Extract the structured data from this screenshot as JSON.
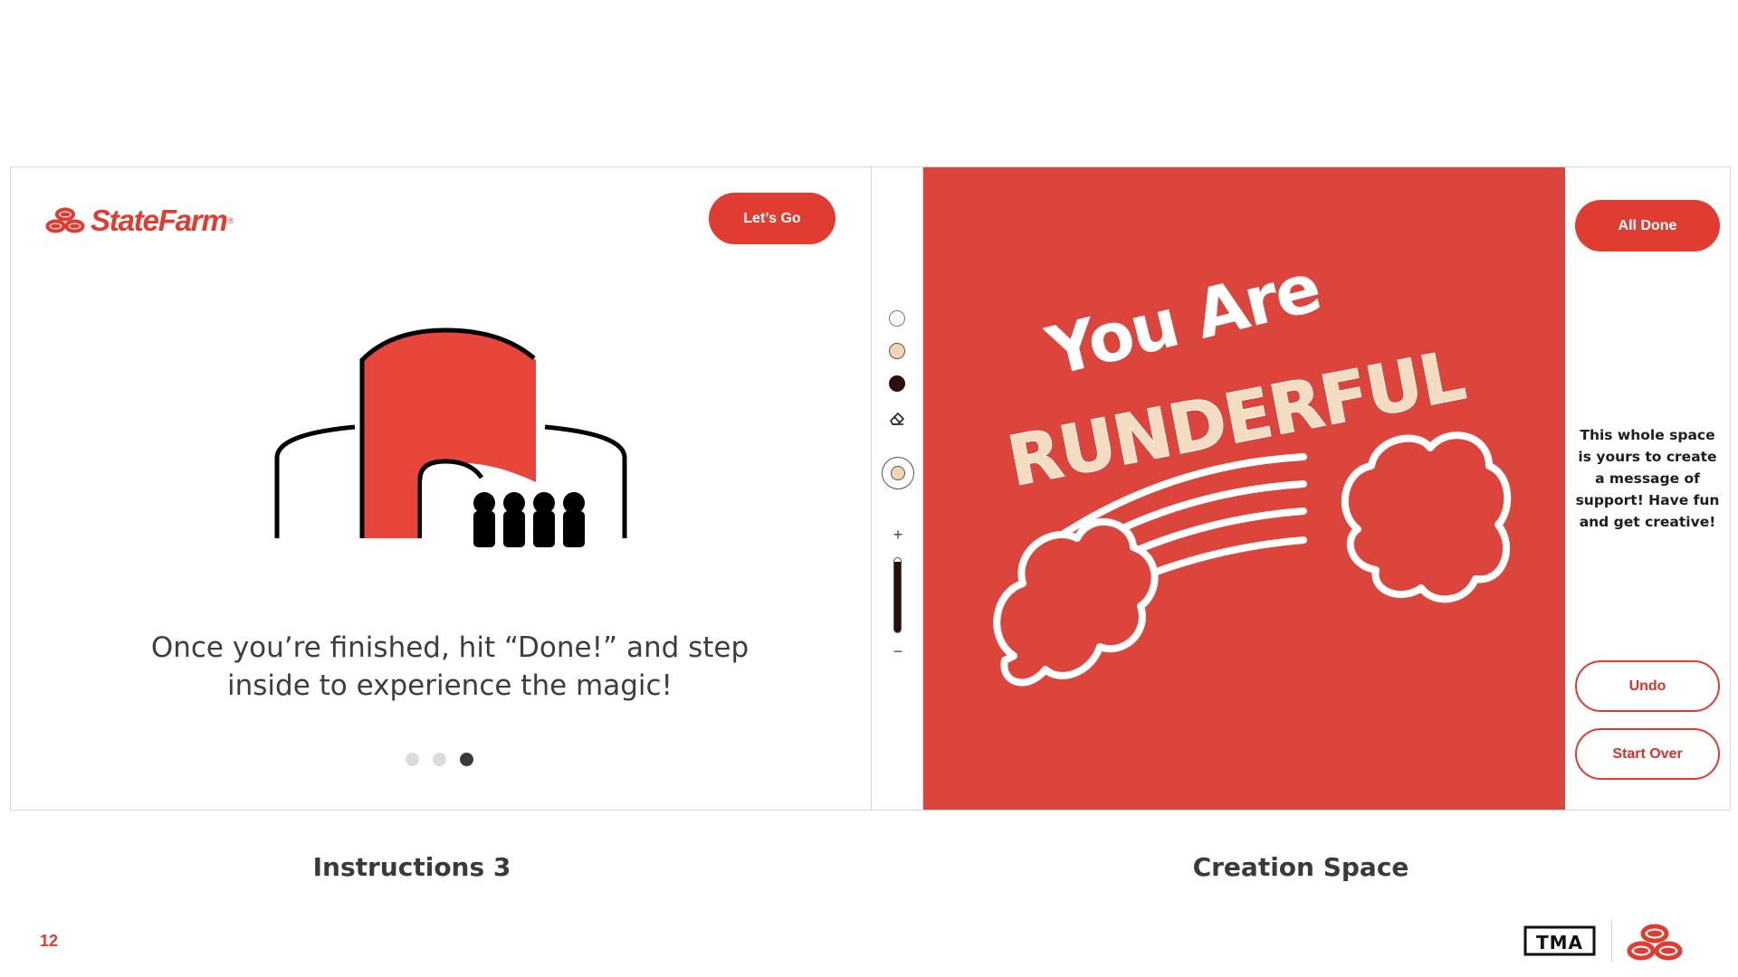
{
  "left_screen": {
    "brand_name": "StateFarm",
    "brand_registered_mark": "®",
    "lets_go_label": "Let’s Go",
    "instruction_line1": "Once you’re finished, hit “Done!” and step",
    "instruction_line2": "inside to experience the magic!",
    "pager": {
      "total": 3,
      "current": 3
    }
  },
  "right_screen": {
    "tools": {
      "colors": [
        "#ffffff",
        "#f0d6b3",
        "#2a0f0a"
      ],
      "selected_color": "#f0d6b3",
      "size_plus_label": "+",
      "size_minus_label": "−",
      "brush_size_fraction": 0.95
    },
    "canvas": {
      "background": "#dc453c",
      "line1": "You Are",
      "line2": "RUNDERFUL"
    },
    "sidebar": {
      "all_done_label": "All Done",
      "message": "This whole space is yours to create a message of support! Have fun and get creative!",
      "undo_label": "Undo",
      "start_over_label": "Start Over"
    }
  },
  "captions": {
    "left": "Instructions 3",
    "right": "Creation Space"
  },
  "footer": {
    "page_number": "12",
    "agency_logo_text": "TMA"
  },
  "colors": {
    "brand_red": "#e03c31",
    "canvas_red": "#dc453c",
    "cream": "#f0d6b3",
    "ink": "#2a0f0a"
  }
}
